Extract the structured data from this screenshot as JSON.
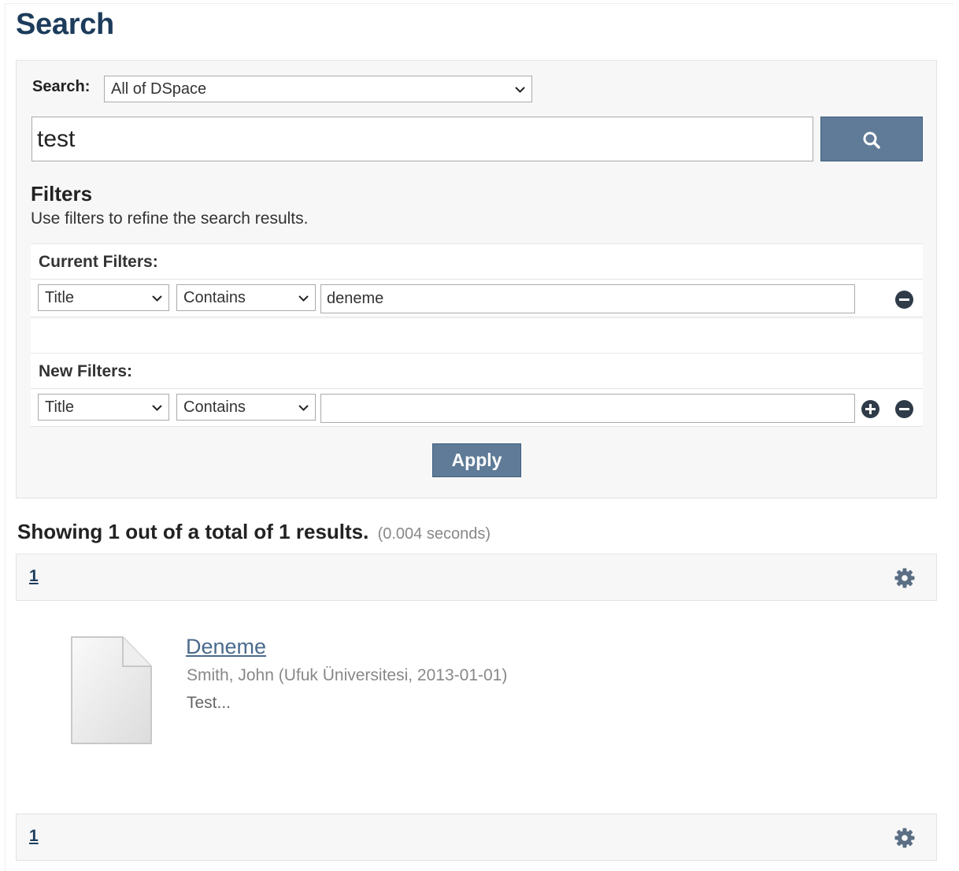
{
  "page": {
    "title": "Search"
  },
  "search": {
    "scope_label": "Search:",
    "scope_value": "All of DSpace",
    "query": "test"
  },
  "filters": {
    "heading": "Filters",
    "help": "Use filters to refine the search results.",
    "current_label": "Current Filters:",
    "current": [
      {
        "field": "Title",
        "operator": "Contains",
        "value": "deneme"
      }
    ],
    "new_label": "New Filters:",
    "new": [
      {
        "field": "Title",
        "operator": "Contains",
        "value": ""
      }
    ],
    "apply_label": "Apply"
  },
  "results": {
    "summary": "Showing 1 out of a total of 1 results.",
    "time": "(0.004 seconds)",
    "pages": [
      "1"
    ],
    "items": [
      {
        "title": "Deneme",
        "meta": "Smith, John (Ufuk Üniversitesi, 2013-01-01)",
        "abstract": "Test..."
      }
    ]
  },
  "icons": {
    "search": "search-icon",
    "remove": "minus-circle-icon",
    "add": "plus-circle-icon",
    "settings": "gear-icon",
    "thumbnail": "document-icon"
  },
  "colors": {
    "title": "#1d3c5c",
    "button": "#5f7b97",
    "panel": "#f7f7f7",
    "link": "#4a6a8c"
  }
}
